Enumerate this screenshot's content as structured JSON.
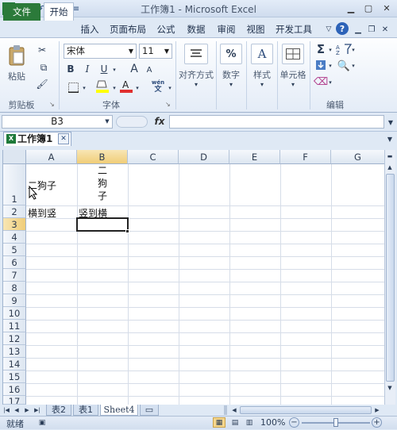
{
  "app": {
    "title": "工作簿1 - Microsoft Excel",
    "icon": "excel-icon"
  },
  "tabs": {
    "file": "文件",
    "home": "开始",
    "insert": "插入",
    "layout": "页面布局",
    "formulas": "公式",
    "data": "数据",
    "review": "审阅",
    "view": "视图",
    "developer": "开发工具"
  },
  "ribbon": {
    "clipboard": {
      "paste": "粘贴",
      "label": "剪贴板"
    },
    "font": {
      "name": "宋体",
      "size": "11",
      "label": "字体",
      "bold": "B",
      "italic": "I",
      "underline": "U",
      "grow": "A",
      "shrink": "A",
      "fill_color": "#ffff00",
      "font_color": "#e03030",
      "wen": "wén",
      "wen_char": "文"
    },
    "alignment": {
      "label": "对齐方式"
    },
    "number": {
      "label": "数字",
      "symbol": "%"
    },
    "styles": {
      "label": "样式",
      "symbol": "A"
    },
    "cells": {
      "label": "单元格"
    },
    "editing": {
      "label": "编辑",
      "sum": "Σ"
    }
  },
  "formula_bar": {
    "name_box": "B3",
    "fx": "fx",
    "value": ""
  },
  "workbook_tab": {
    "title": "工作簿1",
    "close": "✕"
  },
  "grid": {
    "columns": [
      "A",
      "B",
      "C",
      "D",
      "E",
      "F",
      "G"
    ],
    "rows": [
      "1",
      "2",
      "3",
      "4",
      "5",
      "6",
      "7",
      "8",
      "9",
      "10",
      "11",
      "12",
      "13",
      "14",
      "15",
      "16",
      "17"
    ],
    "cells": {
      "A1": "二狗子",
      "B1_lines": [
        "二",
        "狗",
        "子"
      ],
      "A2": "横到竖",
      "B2": "竖到横"
    }
  },
  "sheet_tabs": [
    "表2",
    "表1",
    "Sheet4"
  ],
  "status": {
    "ready": "就绪",
    "zoom": "100%",
    "zoom_level": 1.0
  }
}
